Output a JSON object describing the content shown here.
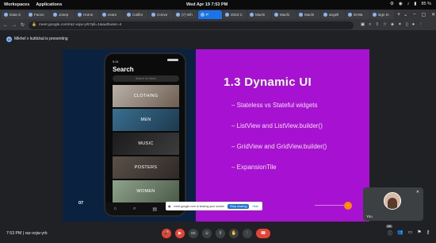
{
  "os": {
    "workspaces": "Workspaces",
    "applications": "Applications",
    "datetime": "Wed Apr 19  7:53 PM",
    "battery": "85 %"
  },
  "browser": {
    "tabs": [
      {
        "label": "Data S"
      },
      {
        "label": "Facon"
      },
      {
        "label": "Josep"
      },
      {
        "label": "Home"
      },
      {
        "label": "exam"
      },
      {
        "label": "Califor"
      },
      {
        "label": "Conve"
      },
      {
        "label": "(7) Wh"
      },
      {
        "label": "P",
        "active": true
      },
      {
        "label": "2023 C"
      },
      {
        "label": "Machi"
      },
      {
        "label": "Machi"
      },
      {
        "label": "Machi"
      },
      {
        "label": "angell"
      },
      {
        "label": "M Ma"
      },
      {
        "label": "sign In"
      }
    ],
    "url": "meet.google.com/raz-xxjw-yrb?pli=1&authuser=4"
  },
  "banner": {
    "text": "Mikhel v kuttickal is presenting"
  },
  "slide": {
    "title": "1.3  Dynamic UI",
    "bullets": [
      "Stateless vs Stateful widgets",
      "ListView and ListView.builder()",
      "GridView and GridView.builder()",
      "ExpansionTile"
    ],
    "number": "07",
    "phone": {
      "time": "9:41",
      "title": "Search",
      "search_placeholder": "Search for items",
      "categories": [
        "CLOTHING",
        "MEN",
        "MUSIC",
        "POSTERS",
        "WOMEN"
      ]
    }
  },
  "sharing_notice": {
    "text": "meet.google.com is sharing your screen",
    "stop": "Stop sharing",
    "hide": "Hide"
  },
  "self_tile": {
    "label": "You"
  },
  "meeting": {
    "time": "7:53 PM",
    "code": "raz-xxjw-yrb",
    "participant_badge": "10"
  },
  "colors": {
    "accent": "#1a73e8",
    "hangup": "#ea4335",
    "slide_purple": "#a711d1",
    "slide_dark": "#0a2240"
  }
}
